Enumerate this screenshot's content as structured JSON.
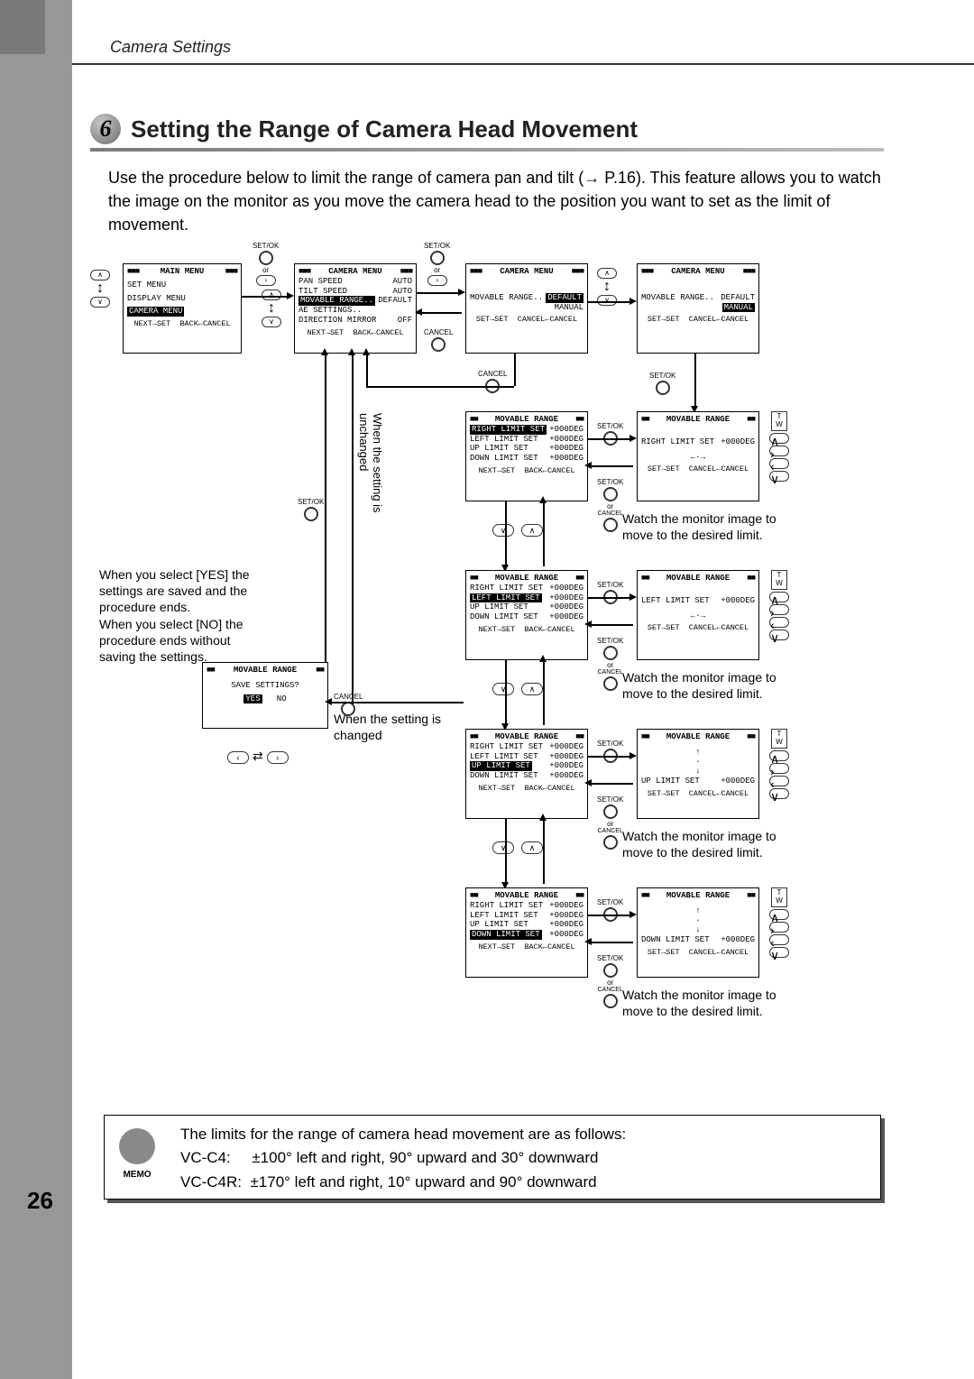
{
  "page": {
    "breadcrumb": "Camera Settings",
    "step": "6",
    "title": "Setting the Range of Camera Head Movement",
    "intro": "Use the procedure below to limit the range of camera pan and tilt (→ P.16). This feature allows you to watch the image on the monitor as you move the camera head to the position you want to set as the limit of movement.",
    "page_number": "26"
  },
  "labels": {
    "setok": "SET/OK",
    "cancel": "CANCEL",
    "or": "or",
    "blk": "■■■",
    "next_set": "NEXT→SET",
    "back_cancel": "BACK←CANCEL",
    "set_set": "SET→SET",
    "cancel_cancel": "CANCEL←CANCEL"
  },
  "osd": {
    "main_menu": {
      "title": "MAIN MENU",
      "items": [
        "SET MENU",
        "DISPLAY MENU",
        "CAMERA MENU"
      ]
    },
    "camera_menu": {
      "title": "CAMERA MENU",
      "pan": "PAN SPEED",
      "pan_v": "AUTO",
      "tilt": "TILT SPEED",
      "tilt_v": "AUTO",
      "mr": "MOVABLE RANGE..",
      "mr_v": "DEFAULT",
      "ae": "AE SETTINGS..",
      "dir": "DIRECTION MIRROR",
      "dir_v": "OFF"
    },
    "mr_default": {
      "title": "CAMERA MENU",
      "line": "MOVABLE RANGE..",
      "opt1": "DEFAULT",
      "opt2": "MANUAL"
    },
    "mr_panel_title": "MOVABLE RANGE",
    "r": "RIGHT LIMIT SET",
    "l": "LEFT LIMIT SET",
    "u": "UP LIMIT SET",
    "d": "DOWN LIMIT SET",
    "deg": "+000DEG",
    "save_q": "SAVE SETTINGS?",
    "yes": "YES",
    "no": "NO"
  },
  "captions": {
    "yes_no": "When you select [YES] the settings are saved and the procedure ends.\nWhen you select [NO] the procedure ends without saving the settings.",
    "unchanged": "When the setting is unchanged",
    "changed": "When the setting is changed",
    "watch": "Watch the monitor image to move to the desired limit."
  },
  "memo": {
    "heading": "MEMO",
    "line1": "The limits for the range of camera head movement are as follows:",
    "line2": "VC-C4:     ±100° left and right, 90° upward and 30° downward",
    "line3": "VC-C4R:  ±170° left and right, 10° upward and 90° downward"
  }
}
